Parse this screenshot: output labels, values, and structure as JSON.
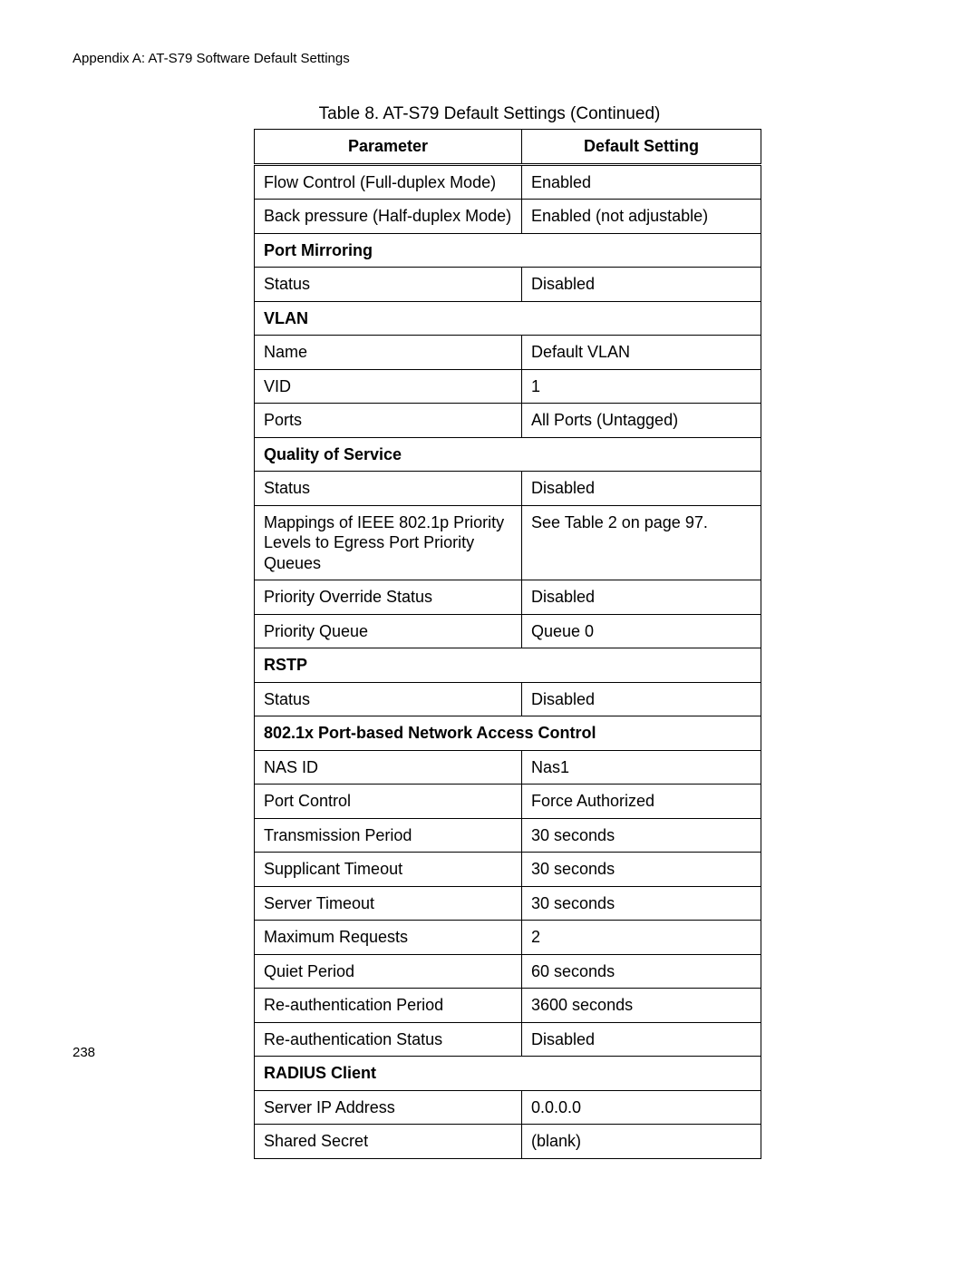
{
  "header": {
    "appendix_title": "Appendix A: AT-S79 Software Default Settings"
  },
  "table": {
    "caption": "Table 8. AT-S79 Default Settings (Continued)",
    "headers": {
      "parameter": "Parameter",
      "default_setting": "Default Setting"
    },
    "rows": [
      {
        "type": "data",
        "parameter": "Flow Control (Full-duplex Mode)",
        "value": "Enabled"
      },
      {
        "type": "data",
        "parameter": "Back pressure (Half-duplex Mode)",
        "value": "Enabled (not adjustable)"
      },
      {
        "type": "section",
        "label": "Port Mirroring"
      },
      {
        "type": "data",
        "parameter": "Status",
        "value": "Disabled"
      },
      {
        "type": "section",
        "label": "VLAN"
      },
      {
        "type": "data",
        "parameter": "Name",
        "value": "Default VLAN"
      },
      {
        "type": "data",
        "parameter": "VID",
        "value": "1"
      },
      {
        "type": "data",
        "parameter": "Ports",
        "value": "All Ports (Untagged)"
      },
      {
        "type": "section",
        "label": "Quality of Service"
      },
      {
        "type": "data",
        "parameter": "Status",
        "value": "Disabled"
      },
      {
        "type": "data",
        "parameter": "Mappings of IEEE 802.1p Priority Levels to Egress Port Priority Queues",
        "value": "See Table 2 on page 97."
      },
      {
        "type": "data",
        "parameter": "Priority Override Status",
        "value": "Disabled"
      },
      {
        "type": "data",
        "parameter": "Priority Queue",
        "value": "Queue 0"
      },
      {
        "type": "section",
        "label": "RSTP"
      },
      {
        "type": "data",
        "parameter": "Status",
        "value": "Disabled"
      },
      {
        "type": "section",
        "label": "802.1x Port-based Network Access Control"
      },
      {
        "type": "data",
        "parameter": "NAS ID",
        "value": "Nas1"
      },
      {
        "type": "data",
        "parameter": "Port Control",
        "value": "Force Authorized"
      },
      {
        "type": "data",
        "parameter": "Transmission Period",
        "value": "30 seconds"
      },
      {
        "type": "data",
        "parameter": "Supplicant Timeout",
        "value": "30 seconds"
      },
      {
        "type": "data",
        "parameter": "Server Timeout",
        "value": "30 seconds"
      },
      {
        "type": "data",
        "parameter": "Maximum Requests",
        "value": "2"
      },
      {
        "type": "data",
        "parameter": "Quiet Period",
        "value": "60 seconds"
      },
      {
        "type": "data",
        "parameter": "Re-authentication Period",
        "value": "3600 seconds"
      },
      {
        "type": "data",
        "parameter": "Re-authentication Status",
        "value": "Disabled"
      },
      {
        "type": "section",
        "label": "RADIUS Client"
      },
      {
        "type": "data",
        "parameter": "Server IP Address",
        "value": "0.0.0.0"
      },
      {
        "type": "data",
        "parameter": "Shared Secret",
        "value": "(blank)"
      }
    ]
  },
  "footer": {
    "page_number": "238"
  }
}
